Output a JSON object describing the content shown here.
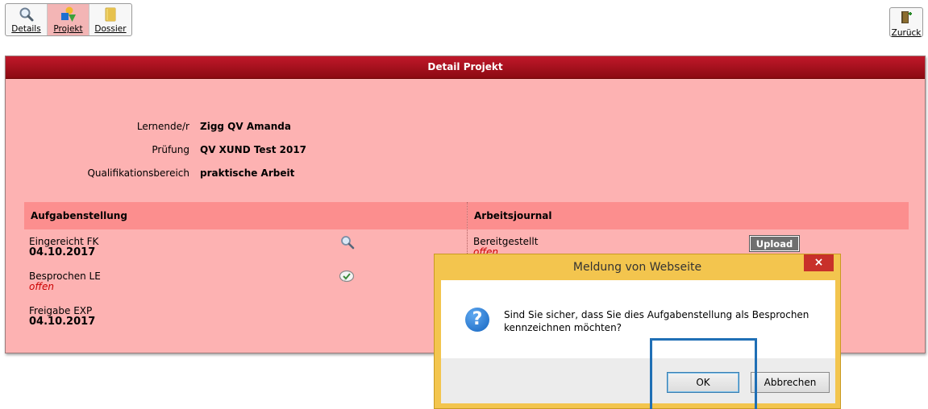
{
  "toolbar": {
    "items": [
      {
        "label": "Details",
        "icon": "magnifier-icon"
      },
      {
        "label": "Projekt",
        "icon": "shapes-icon"
      },
      {
        "label": "Dossier",
        "icon": "folder-icon"
      }
    ],
    "back_label": "Zurück"
  },
  "panel": {
    "title": "Detail Projekt",
    "info": [
      {
        "label": "Lernende/r",
        "value": "Zigg QV Amanda"
      },
      {
        "label": "Prüfung",
        "value": "QV XUND Test 2017"
      },
      {
        "label": "Qualifikationsbereich",
        "value": "praktische Arbeit"
      }
    ],
    "left_section": {
      "title": "Aufgabenstellung",
      "items": [
        {
          "label": "Eingereicht FK",
          "value": "04.10.2017"
        },
        {
          "label": "Besprochen LE",
          "status": "offen"
        },
        {
          "label": "Freigabe EXP",
          "value": "04.10.2017"
        }
      ]
    },
    "right_section": {
      "title": "Arbeitsjournal",
      "items": [
        {
          "label": "Bereitgestellt",
          "status": "offen"
        }
      ],
      "upload_label": "Upload"
    }
  },
  "dialog": {
    "title": "Meldung von Webseite",
    "close_label": "×",
    "message": "Sind Sie sicher, dass Sie dies Aufgabenstellung als Besprochen kennzeichnen möchten?",
    "ok_label": "OK",
    "cancel_label": "Abbrechen"
  },
  "colors": {
    "panel_bg": "#fdb2b2",
    "header_red": "#a8101c",
    "section_bg": "#fc8e8e",
    "status_red": "#cc0000",
    "dialog_frame": "#f3c54e",
    "highlight_blue": "#1f6fb5"
  }
}
